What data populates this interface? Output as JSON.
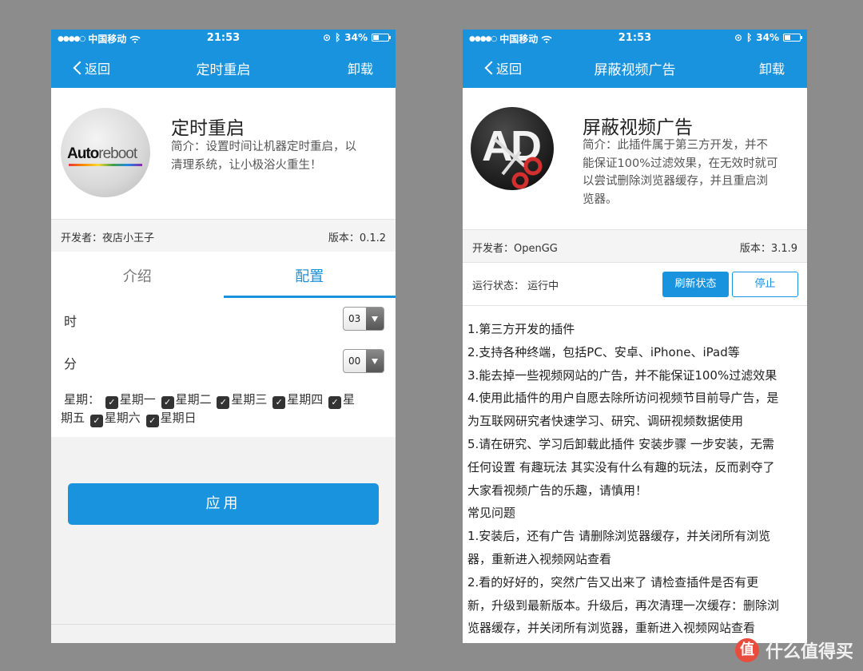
{
  "status_bar": {
    "carrier": "中国移动",
    "time": "21:53",
    "battery": "34%",
    "battery_level": 0.34
  },
  "left": {
    "nav": {
      "back": "返回",
      "title": "定时重启",
      "right": "卸载"
    },
    "app": {
      "icon_text_bold": "Auto",
      "icon_text_light": "reboot",
      "title": "定时重启",
      "desc_line1": "简介：设置时间让机器定时重启，以",
      "desc_line2": "清理系统，让小极浴火重生！"
    },
    "developer": "开发者：夜店小王子",
    "version": "版本：0.1.2",
    "tabs": [
      {
        "label": "介绍"
      },
      {
        "label": "配置"
      }
    ],
    "hour_label": "时",
    "hour_value": "03",
    "minute_label": "分",
    "minute_value": "00",
    "weekday_label": "星期：",
    "weekdays": [
      "星期一",
      "星期二",
      "星期三",
      "星期四",
      "星",
      "期五",
      "星期六",
      "星期日"
    ],
    "apply": "应用"
  },
  "right": {
    "nav": {
      "back": "返回",
      "title": "屏蔽视频广告",
      "right": "卸载"
    },
    "app": {
      "icon_text": "AD",
      "title": "屏蔽视频广告",
      "desc_line1": "简介：此插件属于第三方开发，并不",
      "desc_line2": "能保证100%过滤效果，在无效时就可",
      "desc_line3": "以尝试删除浏览器缓存，并且重启浏",
      "desc_line4": "览器。"
    },
    "developer": "开发者：OpenGG",
    "version": "版本：3.1.9",
    "run_status": "运行状态：  运行中",
    "refresh": "刷新状态",
    "stop": "停止",
    "lines": [
      "1.第三方开发的插件",
      "2.支持各种终端，包括PC、安卓、iPhone、iPad等",
      "3.能去掉一些视频网站的广告，并不能保证100%过滤效果",
      "4.使用此插件的用户自愿去除所访问视频节目前导广告，是",
      "为互联网研究者快速学习、研究、调研视频数据使用",
      "5.请在研究、学习后卸载此插件 安装步骤 一步安装，无需",
      "任何设置 有趣玩法 其实没有什么有趣的玩法，反而剥夺了",
      "大家看视频广告的乐趣，请慎用！",
      "常见问题",
      "1.安装后，还有广告   请删除浏览器缓存，并关闭所有浏览",
      "器，重新进入视频网站查看",
      "2.看的好好的，突然广告又出来了   请检查插件是否有更",
      "新，升级到最新版本。升级后，再次清理一次缓存：删除浏",
      "览器缓存，并关闭所有浏览器，重新进入视频网站查看"
    ]
  },
  "watermark": {
    "badge": "值",
    "text": "什么值得买"
  }
}
